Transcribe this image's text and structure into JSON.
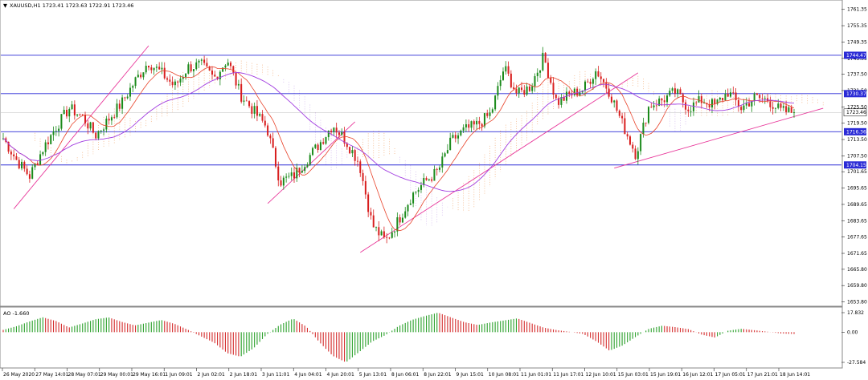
{
  "main_panel": {
    "title": "XAUUSD,H1  1723.41 1723.63 1722.91 1723.46",
    "menu_glyph": "▼"
  },
  "ao_panel": {
    "title": "AO -1.660"
  },
  "colors": {
    "bull": "#1a8a1a",
    "bear": "#d81e1e",
    "level_line": "#2b2bd6",
    "trend_line": "#e8379a",
    "ma_fast": "#e8432a",
    "ma_slow": "#a23ee0",
    "cloud_a": "#f0a266",
    "cloud_b": "#c8a8e8",
    "price_tag_bg": "#2b2bd6",
    "current_tag_bg": "#ffffff",
    "ao_up": "#2aa02a",
    "ao_down": "#d42a2a"
  },
  "chart_data": [
    {
      "type": "candlestick",
      "symbol": "XAUUSD",
      "timeframe": "H1",
      "ohlc_last": {
        "open": 1723.41,
        "high": 1723.63,
        "low": 1722.91,
        "close": 1723.46
      },
      "ylim": [
        1652.5,
        1764.5
      ],
      "y_ticks": [
        1761.35,
        1755.35,
        1749.35,
        1743.35,
        1737.5,
        1731.5,
        1725.5,
        1719.5,
        1713.5,
        1707.5,
        1701.65,
        1695.65,
        1689.65,
        1683.65,
        1677.65,
        1671.65,
        1665.8,
        1659.8,
        1653.8
      ],
      "y_tick_labels": [
        "1761.35",
        "1755.35",
        "1749.35",
        "1743.35",
        "1737.50",
        "1731.50",
        "1725.50",
        "1719.50",
        "1713.50",
        "1707.50",
        "1701.65",
        "1695.65",
        "1689.65",
        "1683.65",
        "1677.65",
        "1671.65",
        "1665.80",
        "1659.80",
        "1653.80"
      ],
      "x_tick_labels": [
        "26 May 2020",
        "27 May 14:01",
        "28 May 07:01",
        "29 May 00:01",
        "29 May 16:01",
        "1 Jun 09:01",
        "2 Jun 02:01",
        "2 Jun 18:01",
        "3 Jun 11:01",
        "4 Jun 04:01",
        "4 Jun 20:01",
        "5 Jun 13:01",
        "8 Jun 06:01",
        "8 Jun 22:01",
        "9 Jun 15:01",
        "10 Jun 08:01",
        "11 Jun 01:01",
        "11 Jun 17:01",
        "12 Jun 10:01",
        "15 Jun 03:01",
        "15 Jun 19:01",
        "16 Jun 12:01",
        "17 Jun 05:01",
        "17 Jun 21:01",
        "18 Jun 14:01"
      ],
      "horizontal_levels": [
        {
          "label": "1744.47",
          "value": 1744.47
        },
        {
          "label": "1730.37",
          "value": 1730.37
        },
        {
          "label": "1716.36",
          "value": 1716.36
        },
        {
          "label": "1704.15",
          "value": 1704.15
        }
      ],
      "current_price": {
        "label": "1723.46",
        "value": 1723.46
      },
      "close_path": [
        1714,
        1706,
        1700,
        1710,
        1718,
        1725,
        1722,
        1715,
        1721,
        1727,
        1735,
        1742,
        1738,
        1733,
        1740,
        1741,
        1736,
        1743,
        1730,
        1724,
        1718,
        1698,
        1700,
        1706,
        1712,
        1719,
        1713,
        1705,
        1682,
        1676,
        1684,
        1693,
        1698,
        1702,
        1713,
        1717,
        1719,
        1723,
        1740,
        1730,
        1733,
        1744,
        1727,
        1730,
        1732,
        1739,
        1731,
        1719,
        1708,
        1726,
        1728,
        1731,
        1725,
        1728,
        1726,
        1731,
        1725,
        1729,
        1728,
        1724,
        1723.46
      ],
      "ao_values": [
        2.1,
        5.4,
        9.8,
        13.6,
        10.2,
        4.3,
        7.9,
        11.8,
        13.5,
        9.4,
        6.2,
        8.7,
        11.1,
        7.6,
        2.3,
        -3.8,
        -9.6,
        -19.2,
        -22.4,
        -14.7,
        -2.1,
        6.8,
        12.4,
        5.1,
        -9.3,
        -21.6,
        -27.584,
        -18.2,
        -8.5,
        -2.7,
        5.6,
        11.2,
        14.8,
        17.832,
        13.4,
        9.1,
        6.6,
        8.9,
        10.7,
        12.6,
        8.4,
        4.2,
        1.9,
        0.3,
        -1.6,
        -8.4,
        -16.9,
        -12.1,
        -4.2,
        3.2,
        5.9,
        4.6,
        2.8,
        -2.3,
        -4.9,
        1.4,
        3.1,
        1.8,
        0.4,
        -1.2,
        -1.66
      ]
    }
  ]
}
